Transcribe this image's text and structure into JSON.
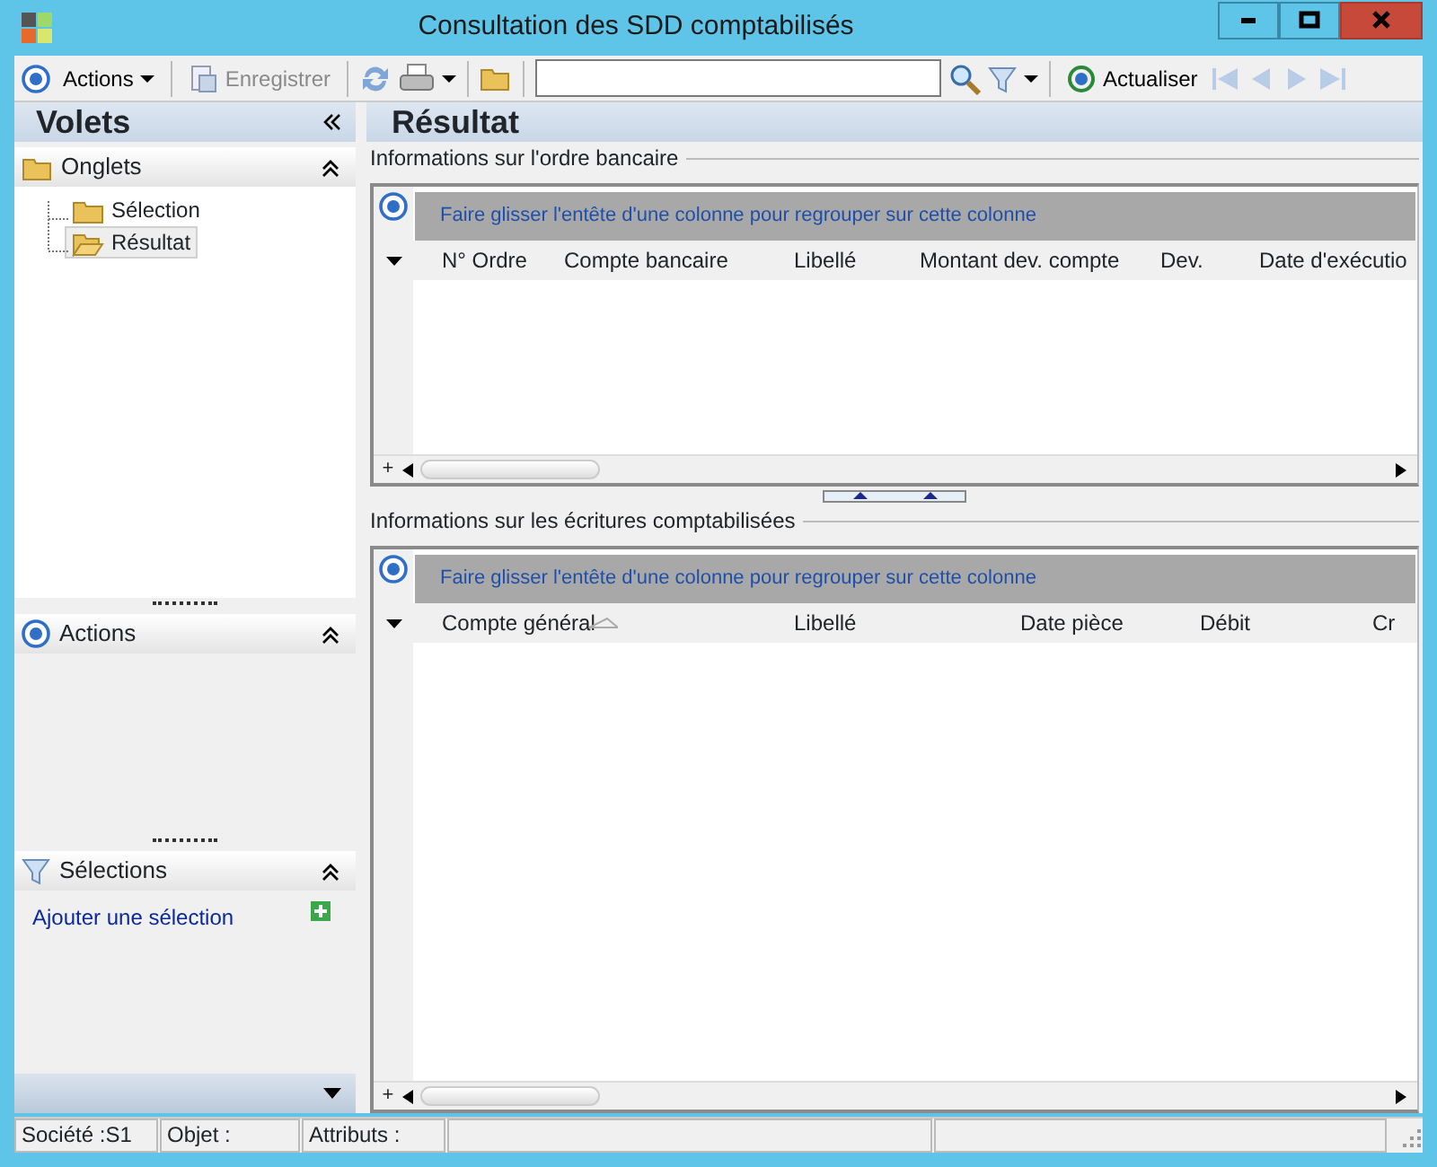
{
  "window": {
    "title": "Consultation des SDD comptabilisés"
  },
  "toolbar": {
    "actions_label": "Actions",
    "save": {
      "label": "Enregistrer",
      "disabled": true
    },
    "refresh_label": "Actualiser",
    "nav_disabled": true
  },
  "sidebar": {
    "title": "Volets",
    "sections": [
      {
        "kind": "tree",
        "title": "Onglets",
        "expanded": true,
        "items": [
          {
            "label": "Sélection",
            "selected": false
          },
          {
            "label": "Résultat",
            "selected": true
          }
        ]
      },
      {
        "kind": "actions",
        "title": "Actions",
        "expanded": true
      },
      {
        "kind": "selections",
        "title": "Sélections",
        "expanded": true,
        "links": [
          "Ajouter une sélection"
        ]
      }
    ]
  },
  "main": {
    "title": "Résultat",
    "grids": [
      {
        "title": "Informations sur l'ordre bancaire",
        "add_sign": "+",
        "group_hint": "Faire glisser l'entête d'une colonne pour regrouper sur cette colonne",
        "columns": [
          {
            "label": "N° Ordre",
            "sorted": false
          },
          {
            "label": "Compte bancaire",
            "sorted": false
          },
          {
            "label": "Libellé",
            "sorted": false
          },
          {
            "label": "Montant dev. compte",
            "sorted": false
          },
          {
            "label": "Dev.",
            "sorted": false
          },
          {
            "label": "Date d'exécutio",
            "sorted": false
          }
        ]
      },
      {
        "title": "Informations sur les écritures comptabilisées",
        "add_sign": "+",
        "group_hint": "Faire glisser l'entête d'une colonne pour regrouper sur cette colonne",
        "columns": [
          {
            "label": "Compte général",
            "sorted": true
          },
          {
            "label": "Libellé",
            "sorted": false
          },
          {
            "label": "Date pièce",
            "sorted": false
          },
          {
            "label": "Débit",
            "sorted": false
          },
          {
            "label": "Cr",
            "sorted": false
          }
        ]
      }
    ]
  },
  "status_bar": [
    "Société :S1",
    "Objet :",
    "Attributs :"
  ]
}
